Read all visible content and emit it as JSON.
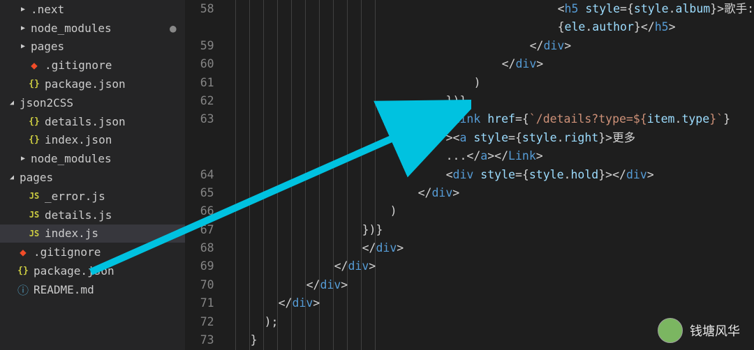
{
  "sidebar": {
    "rows": [
      {
        "indent": 1,
        "chevron": "right",
        "icon": "",
        "label": ".next"
      },
      {
        "indent": 1,
        "chevron": "right",
        "icon": "",
        "label": "node_modules",
        "mod": true
      },
      {
        "indent": 1,
        "chevron": "right",
        "icon": "",
        "label": "pages"
      },
      {
        "indent": 1,
        "chevron": "",
        "icon": "git",
        "label": ".gitignore"
      },
      {
        "indent": 1,
        "chevron": "",
        "icon": "json",
        "label": "package.json"
      },
      {
        "indent": 0,
        "chevron": "down",
        "icon": "",
        "label": "json2CSS"
      },
      {
        "indent": 1,
        "chevron": "",
        "icon": "json",
        "label": "details.json"
      },
      {
        "indent": 1,
        "chevron": "",
        "icon": "json",
        "label": "index.json"
      },
      {
        "indent": 1,
        "chevron": "right",
        "icon": "",
        "label": "node_modules"
      },
      {
        "indent": 0,
        "chevron": "down",
        "icon": "",
        "label": "pages"
      },
      {
        "indent": 1,
        "chevron": "",
        "icon": "js",
        "label": "_error.js"
      },
      {
        "indent": 1,
        "chevron": "",
        "icon": "js",
        "label": "details.js"
      },
      {
        "indent": 1,
        "chevron": "",
        "icon": "js",
        "label": "index.js",
        "selected": true
      },
      {
        "indent": 0,
        "chevron": "",
        "icon": "git",
        "label": ".gitignore"
      },
      {
        "indent": 0,
        "chevron": "",
        "icon": "json",
        "label": "package.json"
      },
      {
        "indent": 0,
        "chevron": "",
        "icon": "info",
        "label": "README.md"
      }
    ]
  },
  "code": {
    "lines": [
      {
        "no": "58",
        "indent": 21,
        "segs": [
          {
            "t": "punct",
            "s": "<"
          },
          {
            "t": "tag",
            "s": "h5"
          },
          {
            "t": "punct",
            "s": " "
          },
          {
            "t": "attr",
            "s": "style"
          },
          {
            "t": "punct",
            "s": "={"
          },
          {
            "t": "var",
            "s": "style"
          },
          {
            "t": "punct",
            "s": "."
          },
          {
            "t": "prop",
            "s": "album"
          },
          {
            "t": "punct",
            "s": "}>"
          },
          {
            "t": "text",
            "s": "歌手:"
          }
        ]
      },
      {
        "no": "",
        "indent": 21,
        "segs": [
          {
            "t": "punct",
            "s": "{"
          },
          {
            "t": "var",
            "s": "ele"
          },
          {
            "t": "punct",
            "s": "."
          },
          {
            "t": "prop",
            "s": "author"
          },
          {
            "t": "punct",
            "s": "}</"
          },
          {
            "t": "tag",
            "s": "h5"
          },
          {
            "t": "punct",
            "s": ">"
          }
        ]
      },
      {
        "no": "59",
        "indent": 19,
        "segs": [
          {
            "t": "punct",
            "s": "</"
          },
          {
            "t": "tag",
            "s": "div"
          },
          {
            "t": "punct",
            "s": ">"
          }
        ]
      },
      {
        "no": "60",
        "indent": 17,
        "segs": [
          {
            "t": "punct",
            "s": "</"
          },
          {
            "t": "tag",
            "s": "div"
          },
          {
            "t": "punct",
            "s": ">"
          }
        ]
      },
      {
        "no": "61",
        "indent": 15,
        "segs": [
          {
            "t": "punct",
            "s": ")"
          }
        ]
      },
      {
        "no": "62",
        "indent": 13,
        "segs": [
          {
            "t": "punct",
            "s": "})}"
          }
        ]
      },
      {
        "no": "63",
        "indent": 13,
        "segs": [
          {
            "t": "punct",
            "s": "<"
          },
          {
            "t": "tag",
            "s": "Link"
          },
          {
            "t": "punct",
            "s": " "
          },
          {
            "t": "attr",
            "s": "href"
          },
          {
            "t": "punct",
            "s": "={"
          },
          {
            "t": "str",
            "s": "`/details?type=${"
          },
          {
            "t": "var",
            "s": "item"
          },
          {
            "t": "punct",
            "s": "."
          },
          {
            "t": "prop",
            "s": "type"
          },
          {
            "t": "str",
            "s": "}`"
          },
          {
            "t": "punct",
            "s": "}"
          }
        ]
      },
      {
        "no": "",
        "indent": 13,
        "segs": [
          {
            "t": "punct",
            "s": "><"
          },
          {
            "t": "tag",
            "s": "a"
          },
          {
            "t": "punct",
            "s": " "
          },
          {
            "t": "attr",
            "s": "style"
          },
          {
            "t": "punct",
            "s": "={"
          },
          {
            "t": "var",
            "s": "style"
          },
          {
            "t": "punct",
            "s": "."
          },
          {
            "t": "prop",
            "s": "right"
          },
          {
            "t": "punct",
            "s": "}>"
          },
          {
            "t": "text",
            "s": "更多"
          }
        ]
      },
      {
        "no": "",
        "indent": 13,
        "segs": [
          {
            "t": "text",
            "s": "..."
          },
          {
            "t": "punct",
            "s": "</"
          },
          {
            "t": "tag",
            "s": "a"
          },
          {
            "t": "punct",
            "s": "></"
          },
          {
            "t": "tag",
            "s": "Link"
          },
          {
            "t": "punct",
            "s": ">"
          }
        ]
      },
      {
        "no": "64",
        "indent": 13,
        "segs": [
          {
            "t": "punct",
            "s": "<"
          },
          {
            "t": "tag",
            "s": "div"
          },
          {
            "t": "punct",
            "s": " "
          },
          {
            "t": "attr",
            "s": "style"
          },
          {
            "t": "punct",
            "s": "={"
          },
          {
            "t": "var",
            "s": "style"
          },
          {
            "t": "punct",
            "s": "."
          },
          {
            "t": "prop",
            "s": "hold"
          },
          {
            "t": "punct",
            "s": "}></"
          },
          {
            "t": "tag",
            "s": "div"
          },
          {
            "t": "punct",
            "s": ">"
          }
        ]
      },
      {
        "no": "65",
        "indent": 11,
        "segs": [
          {
            "t": "punct",
            "s": "</"
          },
          {
            "t": "tag",
            "s": "div"
          },
          {
            "t": "punct",
            "s": ">"
          }
        ]
      },
      {
        "no": "66",
        "indent": 9,
        "segs": [
          {
            "t": "punct",
            "s": ")"
          }
        ]
      },
      {
        "no": "67",
        "indent": 7,
        "segs": [
          {
            "t": "punct",
            "s": "})}"
          }
        ]
      },
      {
        "no": "68",
        "indent": 7,
        "segs": [
          {
            "t": "punct",
            "s": "</"
          },
          {
            "t": "tag",
            "s": "div"
          },
          {
            "t": "punct",
            "s": ">"
          }
        ]
      },
      {
        "no": "69",
        "indent": 5,
        "segs": [
          {
            "t": "punct",
            "s": "</"
          },
          {
            "t": "tag",
            "s": "div"
          },
          {
            "t": "punct",
            "s": ">"
          }
        ]
      },
      {
        "no": "70",
        "indent": 3,
        "segs": [
          {
            "t": "punct",
            "s": "</"
          },
          {
            "t": "tag",
            "s": "div"
          },
          {
            "t": "punct",
            "s": ">"
          }
        ]
      },
      {
        "no": "71",
        "indent": 1,
        "segs": [
          {
            "t": "punct",
            "s": "</"
          },
          {
            "t": "tag",
            "s": "div"
          },
          {
            "t": "punct",
            "s": ">"
          }
        ]
      },
      {
        "no": "72",
        "indent": 0,
        "segs": [
          {
            "t": "punct",
            "s": ");"
          }
        ]
      },
      {
        "no": "73",
        "indent": -1,
        "segs": [
          {
            "t": "punct",
            "s": "}"
          }
        ]
      }
    ]
  },
  "watermark": {
    "text": "钱塘风华"
  }
}
